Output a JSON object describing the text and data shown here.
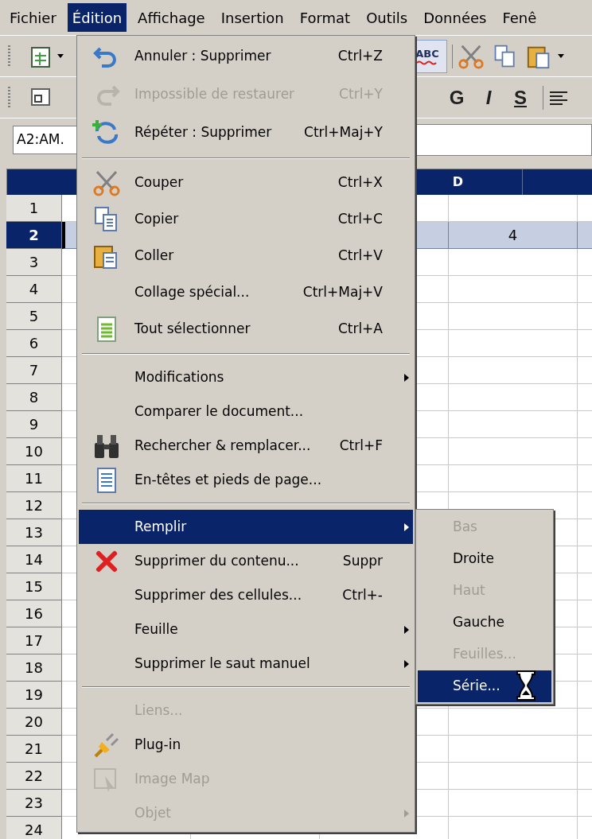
{
  "menubar": [
    {
      "label": "Fichier",
      "selected": false
    },
    {
      "label": "Édition",
      "selected": true
    },
    {
      "label": "Affichage",
      "selected": false
    },
    {
      "label": "Insertion",
      "selected": false
    },
    {
      "label": "Format",
      "selected": false
    },
    {
      "label": "Outils",
      "selected": false
    },
    {
      "label": "Données",
      "selected": false
    },
    {
      "label": "Fenê",
      "selected": false
    }
  ],
  "toolbar": {
    "spellcheck_text": "ABC",
    "format_buttons": [
      "G",
      "I",
      "S"
    ]
  },
  "name_box": {
    "value": "A2:AM."
  },
  "sheet": {
    "visible_column_header": "D",
    "rows": [
      {
        "label": "1",
        "selected": false
      },
      {
        "label": "2",
        "selected": true,
        "d_value": "4"
      },
      {
        "label": "3",
        "selected": false
      },
      {
        "label": "4",
        "selected": false
      },
      {
        "label": "5",
        "selected": false
      },
      {
        "label": "6",
        "selected": false
      },
      {
        "label": "7",
        "selected": false
      },
      {
        "label": "8",
        "selected": false
      },
      {
        "label": "9",
        "selected": false
      },
      {
        "label": "10",
        "selected": false
      },
      {
        "label": "11",
        "selected": false
      },
      {
        "label": "12",
        "selected": false
      },
      {
        "label": "13",
        "selected": false
      },
      {
        "label": "14",
        "selected": false
      },
      {
        "label": "15",
        "selected": false
      },
      {
        "label": "16",
        "selected": false
      },
      {
        "label": "17",
        "selected": false
      },
      {
        "label": "18",
        "selected": false
      },
      {
        "label": "19",
        "selected": false
      },
      {
        "label": "20",
        "selected": false
      },
      {
        "label": "21",
        "selected": false
      },
      {
        "label": "22",
        "selected": false
      },
      {
        "label": "23",
        "selected": false
      },
      {
        "label": "24",
        "selected": false
      }
    ]
  },
  "edit_menu": {
    "items": [
      {
        "kind": "item",
        "label": "Annuler : Supprimer",
        "shortcut": "Ctrl+Z",
        "disabled": false,
        "selected": false,
        "submenu": false
      },
      {
        "kind": "item",
        "label": "Impossible de restaurer",
        "shortcut": "Ctrl+Y",
        "disabled": true,
        "selected": false,
        "submenu": false
      },
      {
        "kind": "item",
        "label": "Répéter : Supprimer",
        "shortcut": "Ctrl+Maj+Y",
        "disabled": false,
        "selected": false,
        "submenu": false
      },
      {
        "kind": "separator"
      },
      {
        "kind": "item",
        "label": "Couper",
        "shortcut": "Ctrl+X",
        "disabled": false,
        "selected": false,
        "submenu": false
      },
      {
        "kind": "item",
        "label": "Copier",
        "shortcut": "Ctrl+C",
        "disabled": false,
        "selected": false,
        "submenu": false
      },
      {
        "kind": "item",
        "label": "Coller",
        "shortcut": "Ctrl+V",
        "disabled": false,
        "selected": false,
        "submenu": false
      },
      {
        "kind": "item",
        "label": "Collage spécial...",
        "shortcut": "Ctrl+Maj+V",
        "disabled": false,
        "selected": false,
        "submenu": false
      },
      {
        "kind": "item",
        "label": "Tout sélectionner",
        "shortcut": "Ctrl+A",
        "disabled": false,
        "selected": false,
        "submenu": false
      },
      {
        "kind": "separator"
      },
      {
        "kind": "item",
        "label": "Modifications",
        "disabled": false,
        "selected": false,
        "submenu": true
      },
      {
        "kind": "item",
        "label": "Comparer le document...",
        "disabled": false,
        "selected": false,
        "submenu": false
      },
      {
        "kind": "item",
        "label": "Rechercher & remplacer...",
        "shortcut": "Ctrl+F",
        "disabled": false,
        "selected": false,
        "submenu": false
      },
      {
        "kind": "item",
        "label": "En-têtes et pieds de page...",
        "disabled": false,
        "selected": false,
        "submenu": false
      },
      {
        "kind": "separator"
      },
      {
        "kind": "item",
        "label": "Remplir",
        "disabled": false,
        "selected": true,
        "submenu": true
      },
      {
        "kind": "item",
        "label": "Supprimer du contenu...",
        "shortcut": "Suppr",
        "disabled": false,
        "selected": false,
        "submenu": false
      },
      {
        "kind": "item",
        "label": "Supprimer des cellules...",
        "shortcut": "Ctrl+-",
        "disabled": false,
        "selected": false,
        "submenu": false
      },
      {
        "kind": "item",
        "label": "Feuille",
        "disabled": false,
        "selected": false,
        "submenu": true
      },
      {
        "kind": "item",
        "label": "Supprimer le saut manuel",
        "disabled": false,
        "selected": false,
        "submenu": true
      },
      {
        "kind": "separator"
      },
      {
        "kind": "item",
        "label": "Liens...",
        "disabled": true,
        "selected": false,
        "submenu": false
      },
      {
        "kind": "item",
        "label": "Plug-in",
        "disabled": false,
        "selected": false,
        "submenu": false
      },
      {
        "kind": "item",
        "label": "Image Map",
        "disabled": true,
        "selected": false,
        "submenu": false
      },
      {
        "kind": "item",
        "label": "Objet",
        "disabled": true,
        "selected": false,
        "submenu": true
      }
    ]
  },
  "fill_submenu": {
    "items": [
      {
        "label": "Bas",
        "disabled": true,
        "selected": false
      },
      {
        "label": "Droite",
        "disabled": false,
        "selected": false
      },
      {
        "label": "Haut",
        "disabled": true,
        "selected": false
      },
      {
        "label": "Gauche",
        "disabled": false,
        "selected": false
      },
      {
        "label": "Feuilles...",
        "disabled": true,
        "selected": false
      },
      {
        "label": "Série...",
        "disabled": false,
        "selected": true
      }
    ]
  }
}
